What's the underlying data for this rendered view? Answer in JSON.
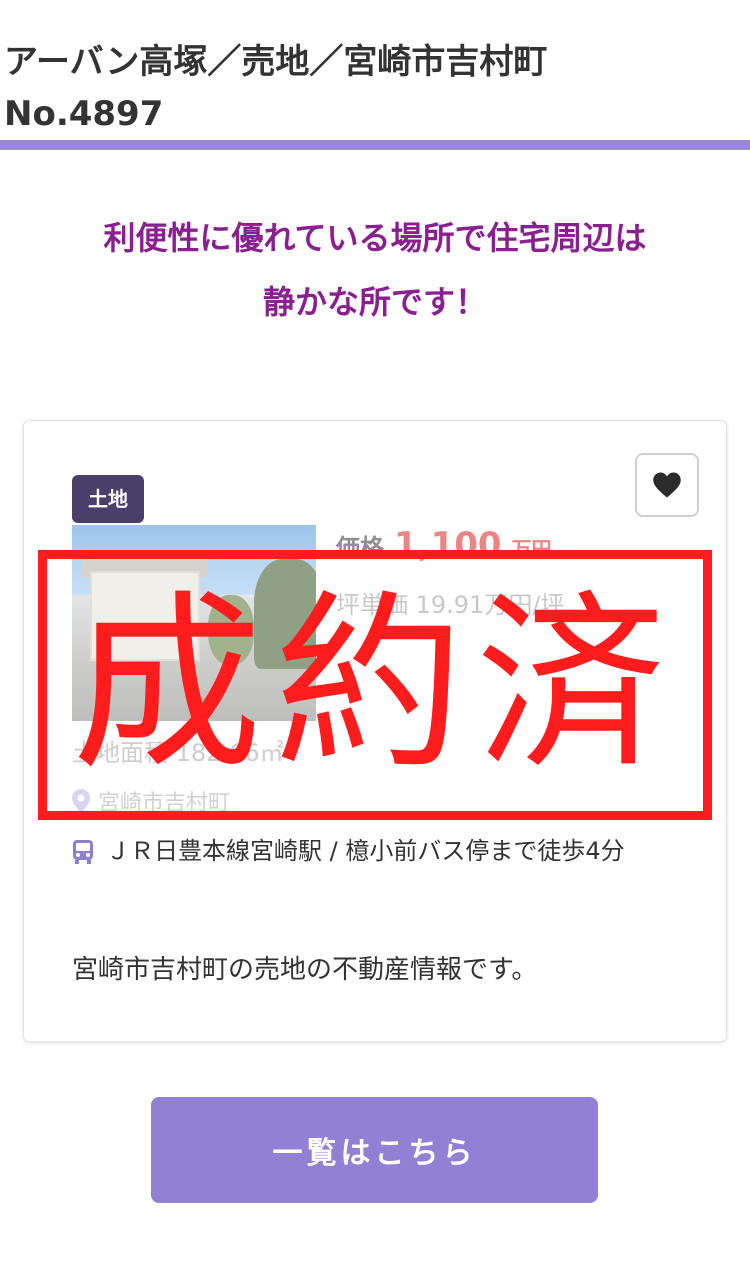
{
  "header": {
    "title_line1": "アーバン高塚／売地／宮崎市吉村町",
    "title_line2": "No.4897",
    "rule_color": "#9a87d6"
  },
  "catch_copy": {
    "line1": "利便性に優れている場所で住宅周辺は",
    "line2": "静かな所です！",
    "color": "#8a1f8f"
  },
  "listing": {
    "tag": "土地",
    "favorite_icon": "heart-icon",
    "price_label": "価格",
    "price_value": "1,100",
    "price_unit": "万円",
    "unit_price": "坪単価 19.91万円/坪",
    "land_area": "土地面積 182.66㎡",
    "location": "宮崎市吉村町",
    "location_icon": "map-pin-icon",
    "access": "ＪＲ日豊本線宮崎駅 / 檍小前バス停まで徒歩4分",
    "access_icon": "bus-icon",
    "description": "宮崎市吉村町の売地の不動産情報です。"
  },
  "stamp": {
    "text": "成約済",
    "color": "#ff1c1c"
  },
  "list_button": {
    "label": "一覧はこちら",
    "color": "#9180d4"
  }
}
